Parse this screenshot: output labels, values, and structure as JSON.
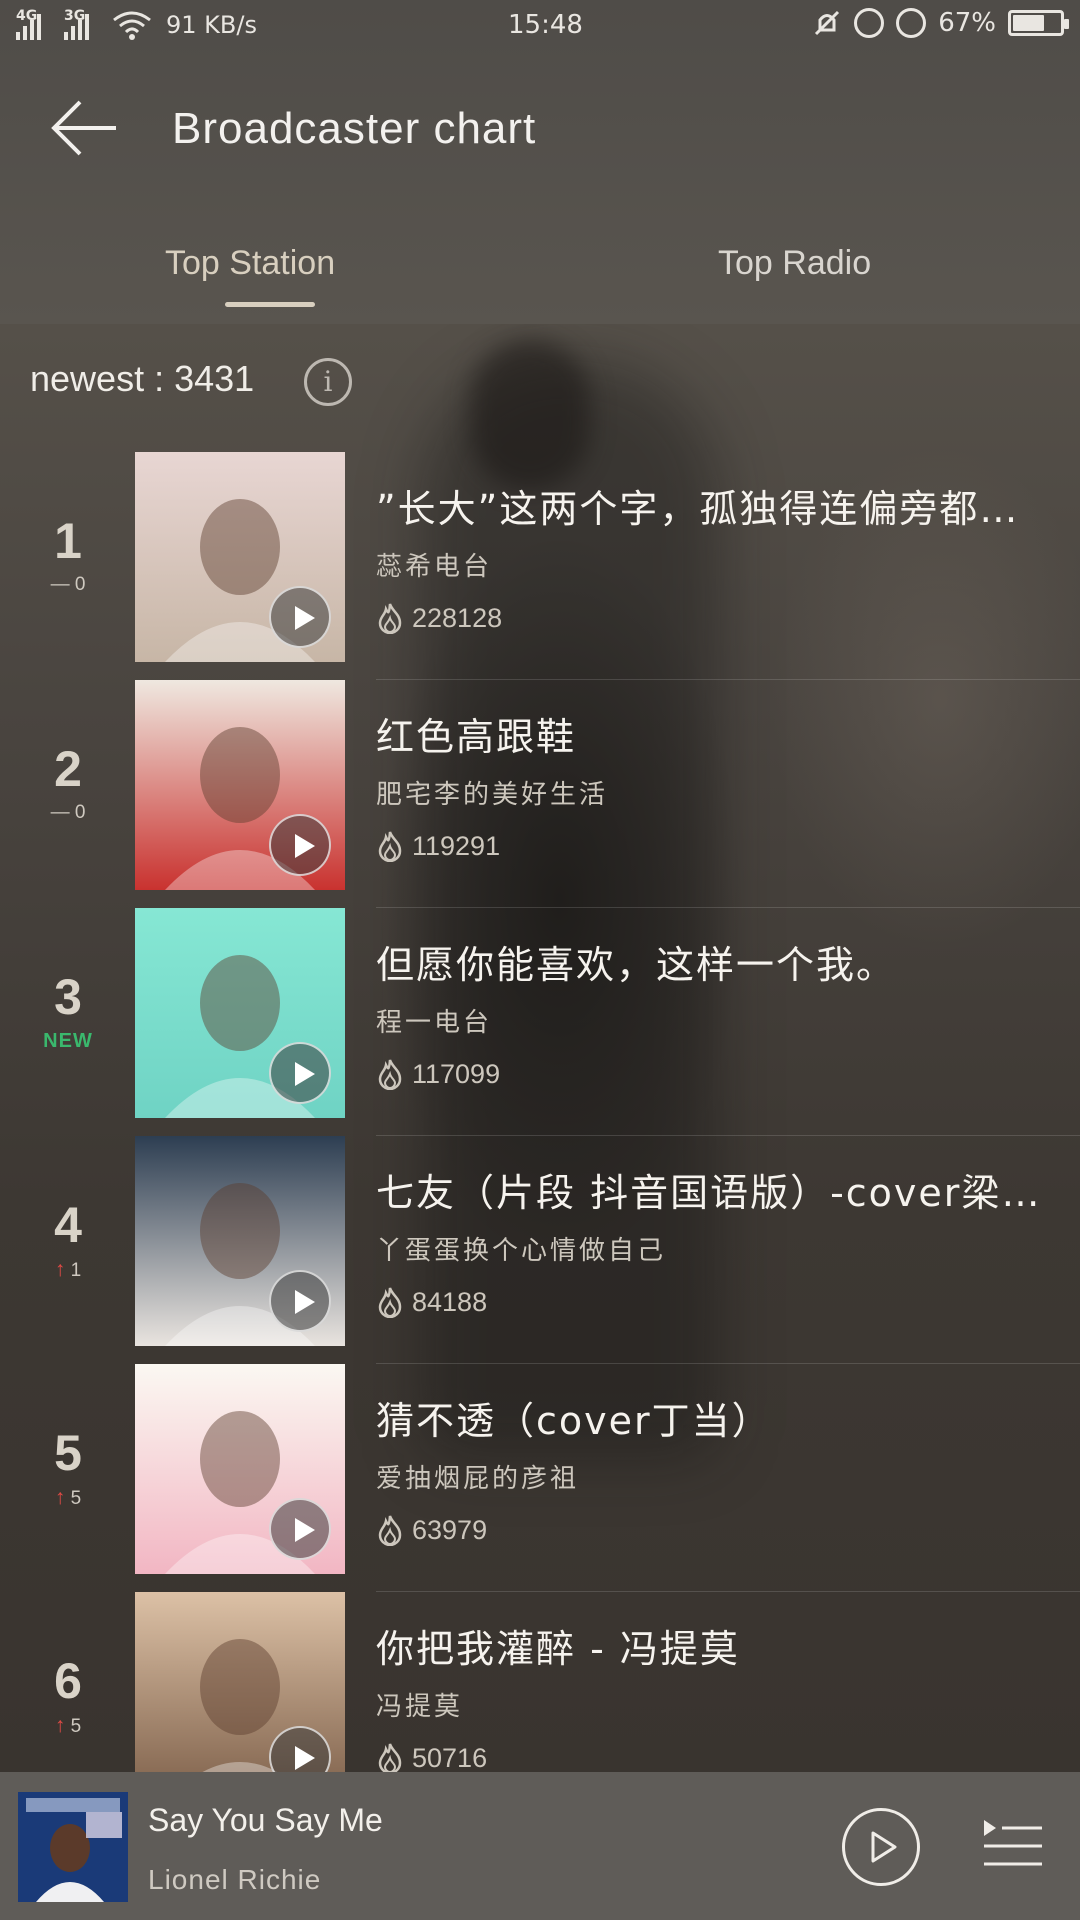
{
  "status_bar": {
    "network_1": "4G",
    "network_2": "3G",
    "speed": "91 KB/s",
    "time": "15:48",
    "battery": "67%",
    "battery_level": 0.67
  },
  "header": {
    "title": "Broadcaster chart"
  },
  "tabs": [
    {
      "label": "Top Station",
      "active": true
    },
    {
      "label": "Top Radio",
      "active": false
    }
  ],
  "newest": {
    "label": "newest : 3431",
    "info_glyph": "i"
  },
  "items": [
    {
      "rank": "1",
      "change": "— 0",
      "change_type": "same",
      "title": "”长大”这两个字，孤独得连偏旁都没有",
      "subtitle": "蕊希电台",
      "plays": "228128",
      "thumb_colors": [
        "#e8d6d3",
        "#c7b6a6"
      ]
    },
    {
      "rank": "2",
      "change": "— 0",
      "change_type": "same",
      "title": "红色高跟鞋",
      "subtitle": "肥宅李的美好生活",
      "plays": "119291",
      "thumb_colors": [
        "#efe8e0",
        "#c9322f"
      ]
    },
    {
      "rank": "3",
      "change": "NEW",
      "change_type": "new",
      "title": "但愿你能喜欢，这样一个我。",
      "subtitle": "程一电台",
      "plays": "117099",
      "thumb_colors": [
        "#86e7d4",
        "#6fd3c4"
      ]
    },
    {
      "rank": "4",
      "change": "1",
      "change_type": "up",
      "title": "七友（片段 抖音国语版）-cover梁汉文",
      "subtitle": "丫蛋蛋换个心情做自己",
      "plays": "84188",
      "thumb_colors": [
        "#2d3e52",
        "#e9e4df"
      ]
    },
    {
      "rank": "5",
      "change": "5",
      "change_type": "up",
      "title": "猜不透（cover丁当）",
      "subtitle": "爱抽烟屁的彦祖",
      "plays": "63979",
      "thumb_colors": [
        "#fbf8f2",
        "#f2b6c3"
      ]
    },
    {
      "rank": "6",
      "change": "5",
      "change_type": "up",
      "title": "你把我灌醉 - 冯提莫",
      "subtitle": "冯提莫",
      "plays": "50716",
      "thumb_colors": [
        "#dcc1a6",
        "#7d5f49"
      ]
    }
  ],
  "player": {
    "song": "Say You Say Me",
    "artist": "Lionel Richie"
  },
  "colors": {
    "accent_tab": "#d8cfbf",
    "rank_up": "#e04a45",
    "rank_new": "#3ab86d"
  },
  "icons": [
    "back-arrow-icon",
    "info-icon",
    "flame-icon",
    "play-icon",
    "playlist-icon"
  ]
}
